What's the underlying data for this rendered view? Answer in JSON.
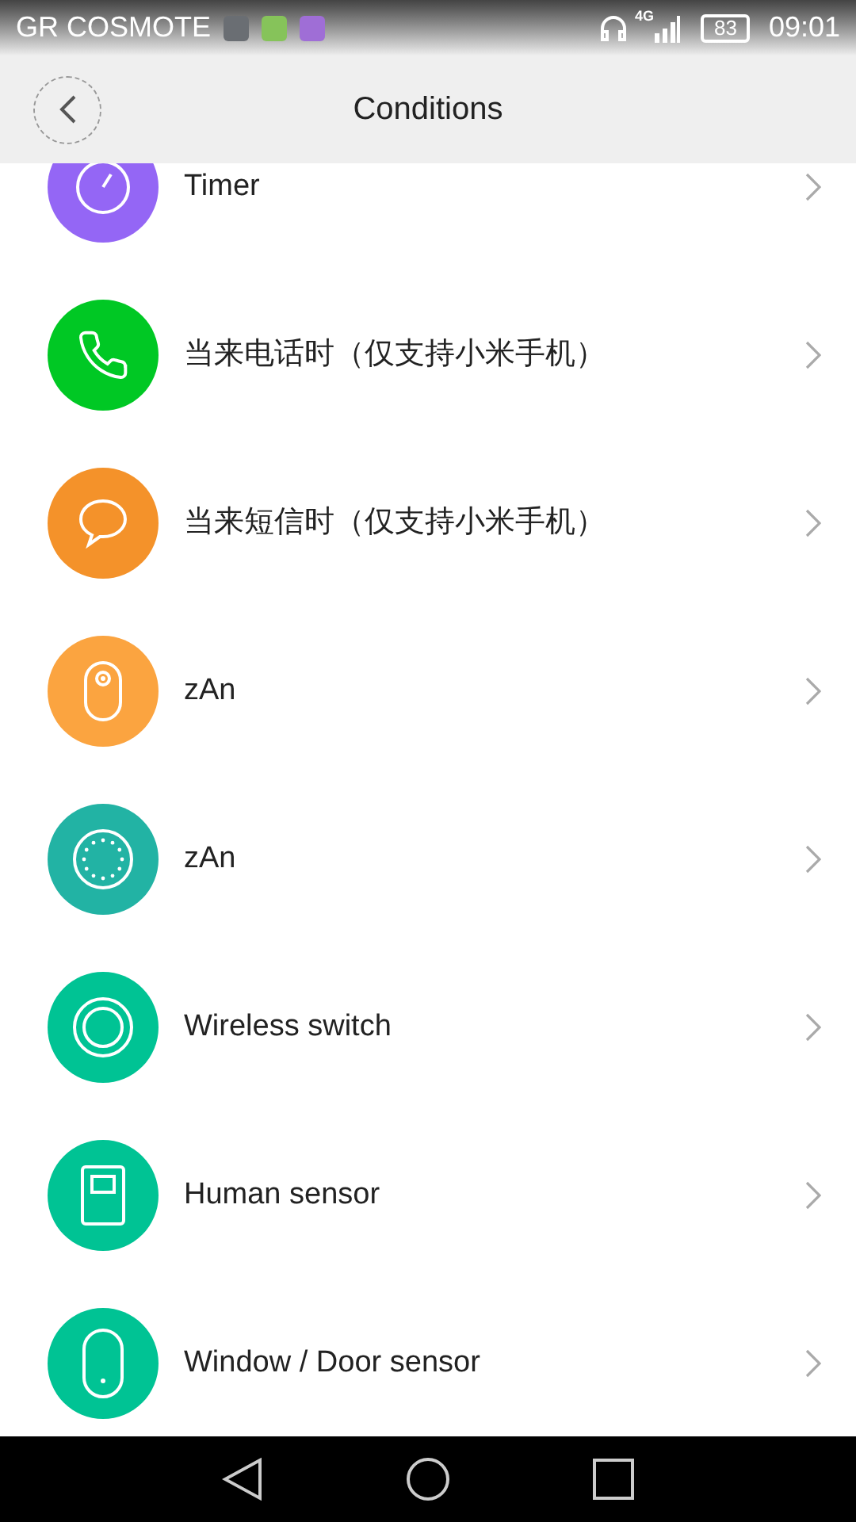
{
  "status_bar": {
    "carrier": "GR COSMOTE",
    "network": "4G",
    "battery": "83",
    "time": "09:01"
  },
  "header": {
    "title": "Conditions"
  },
  "conditions": [
    {
      "label": "Timer",
      "color": "#9466f5"
    },
    {
      "label": "当来电话时（仅支持小米手机）",
      "color": "#00c824"
    },
    {
      "label": "当来短信时（仅支持小米手机）",
      "color": "#f4922a"
    },
    {
      "label": "zAn",
      "color": "#fba440"
    },
    {
      "label": "zAn",
      "color": "#22b3a4"
    },
    {
      "label": "Wireless switch",
      "color": "#00c394"
    },
    {
      "label": "Human sensor",
      "color": "#00c394"
    },
    {
      "label": "Window / Door sensor",
      "color": "#00c394"
    }
  ]
}
